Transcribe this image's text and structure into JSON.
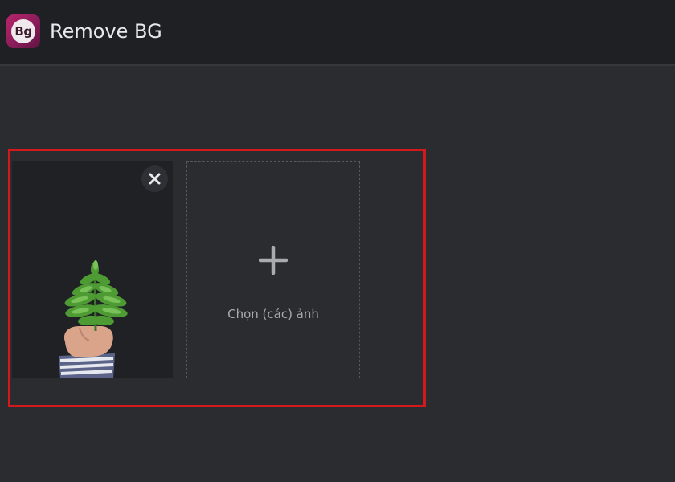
{
  "header": {
    "logo_text": "Bg",
    "app_title": "Remove BG"
  },
  "uploads": {
    "images": [
      {
        "alt": "fern leaf held in hand"
      }
    ],
    "add_tile": {
      "label": "Chọn (các) ảnh"
    }
  },
  "icons": {
    "remove": "close-icon",
    "add": "plus-icon"
  },
  "colors": {
    "header_bg": "#1f2023",
    "page_bg": "#2a2c30",
    "highlight": "#d4191e",
    "logo": "#a8225f"
  }
}
